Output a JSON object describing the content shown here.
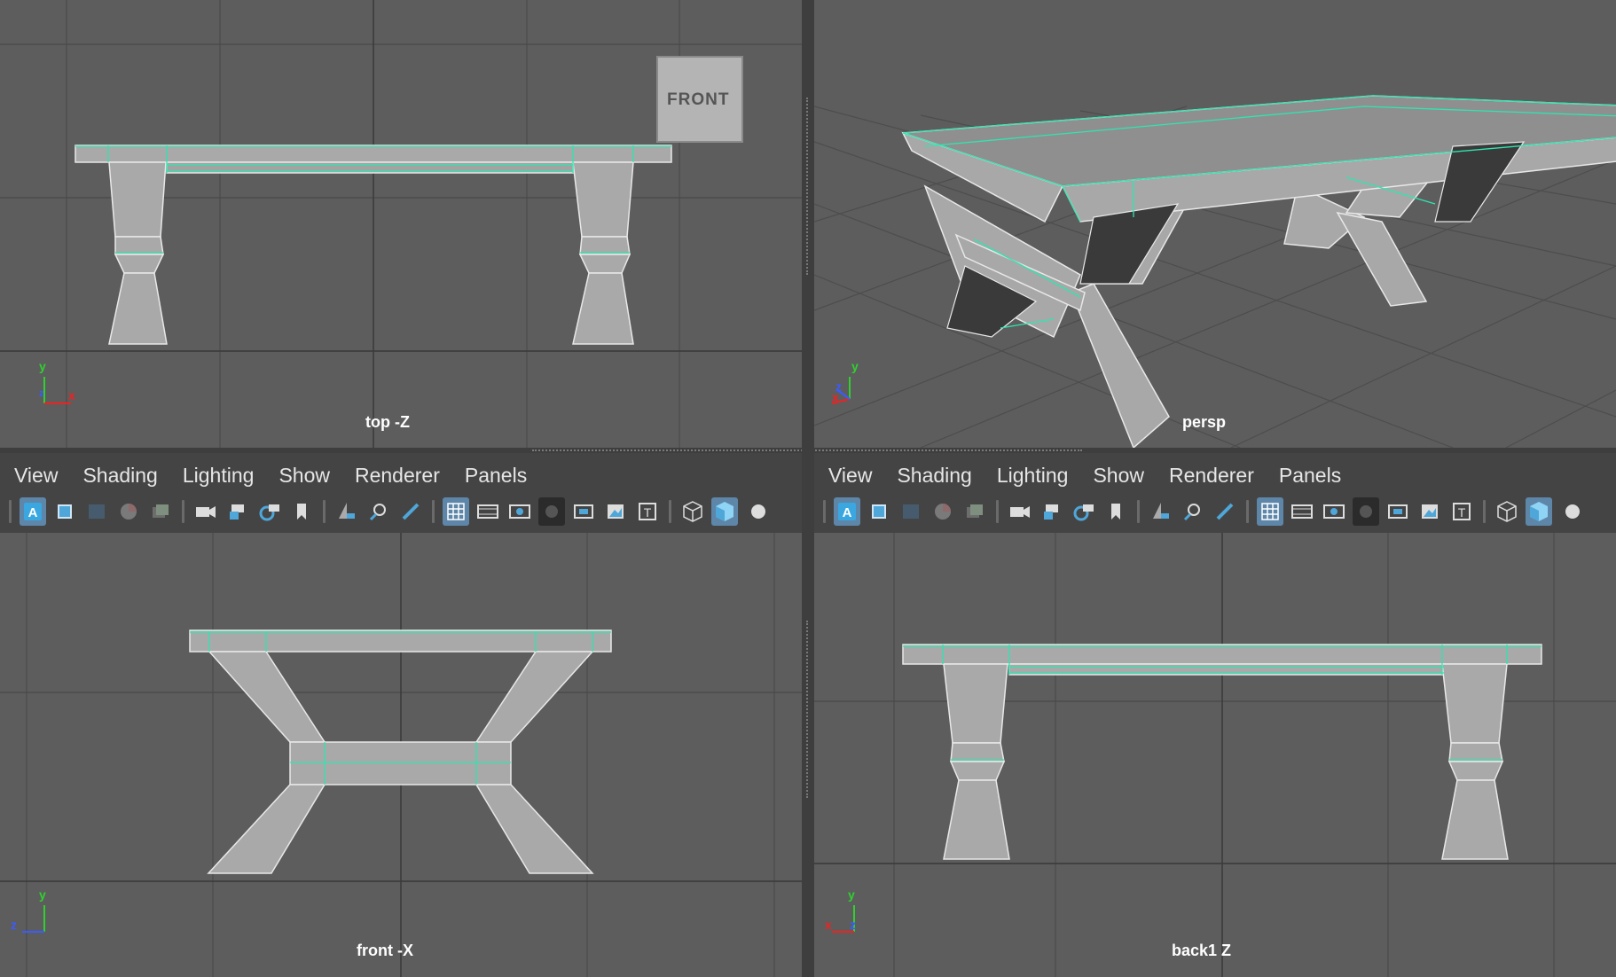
{
  "viewports": {
    "top_left": {
      "label": "top -Z",
      "viewcube": "FRONT"
    },
    "top_right": {
      "label": "persp"
    },
    "bottom_left": {
      "label": "front -X"
    },
    "bottom_right": {
      "label": "back1 Z"
    }
  },
  "menus": [
    "View",
    "Shading",
    "Lighting",
    "Show",
    "Renderer",
    "Panels"
  ],
  "axes": {
    "top_left": {
      "up": "y",
      "right": "x",
      "depth": "z"
    },
    "top_right": {
      "up": "y",
      "right": "x",
      "depth": "z"
    },
    "bottom_left": {
      "up": "y",
      "left": "z"
    },
    "bottom_right": {
      "up": "y",
      "left": "x",
      "depth": "z"
    }
  },
  "toolbar_icons": [
    "select-camera-icon",
    "frame-icon",
    "grid-view-icon",
    "color-wheel-icon",
    "layers-icon",
    "camera-icon",
    "lock-camera-icon",
    "camera-attributes-icon",
    "bookmark-icon",
    "image-plane-icon",
    "track-icon",
    "paint-icon",
    "grid-icon",
    "film-gate-icon",
    "resolution-gate-icon",
    "gate-mask-icon",
    "field-chart-icon",
    "safe-action-icon",
    "safe-title-icon",
    "wireframe-icon",
    "smooth-shade-icon",
    "more-icon"
  ],
  "colors": {
    "accent": "#5d86a8",
    "wire": "#2ee6b0",
    "viewport_bg": "#5d5d5d"
  }
}
